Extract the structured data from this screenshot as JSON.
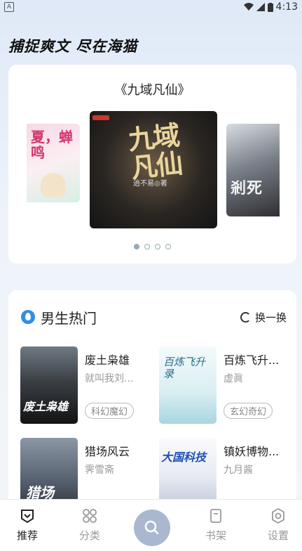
{
  "status_bar": {
    "time": "4:13"
  },
  "slogan": "捕捉爽文 尽在海猫",
  "featured": {
    "title": "《九域凡仙》",
    "covers": [
      {
        "title_text": "夏，蝉鸣"
      },
      {
        "title_text": "九域凡仙",
        "author_text": "逍不易◎著"
      },
      {
        "title_text": "剎死"
      }
    ],
    "page_count": 4,
    "active_page": 0
  },
  "hot": {
    "title": "男生热门",
    "refresh_label": "换一换",
    "books": [
      {
        "title": "废土枭雄",
        "author": "就叫我刘...",
        "tag": "科幻魔幻",
        "cover_text": "废土枭雄"
      },
      {
        "title": "百炼飞升...",
        "author": "虚眞",
        "tag": "玄幻奇幻",
        "cover_text": "百炼飞升录"
      },
      {
        "title": "猎场风云",
        "author": "霁雪斋",
        "tag": "",
        "cover_text": "猎场"
      },
      {
        "title": "镇妖博物...",
        "author": "九月酱",
        "tag": "",
        "cover_text": "大国科技"
      }
    ]
  },
  "tabbar": {
    "items": [
      {
        "label": "推荐",
        "icon": "recommend-icon",
        "active": true
      },
      {
        "label": "分类",
        "icon": "category-icon",
        "active": false
      },
      {
        "label": "",
        "icon": "search-icon",
        "active": false
      },
      {
        "label": "书架",
        "icon": "bookshelf-icon",
        "active": false
      },
      {
        "label": "设置",
        "icon": "settings-icon",
        "active": false
      }
    ]
  },
  "colors": {
    "accent": "#2f8fe8",
    "search_fab": "#a9b8cf"
  }
}
